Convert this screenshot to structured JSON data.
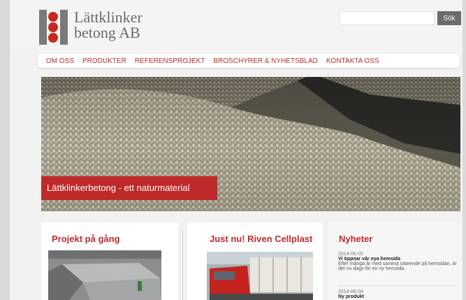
{
  "header": {
    "logo_line1": "Lättklinker",
    "logo_line2": "betong AB",
    "search_placeholder": "",
    "search_button": "Sök"
  },
  "nav": {
    "items": [
      "OM OSS",
      "PRODUKTER",
      "REFERENSPROJEKT",
      "BROSCHYRER & NYHETSBLAD",
      "KONTAKTA OSS"
    ]
  },
  "hero": {
    "caption": "Lättklinkerbetong - ett naturmaterial"
  },
  "columns": {
    "projects_title": "Projekt på gång",
    "news_flash_title": "Just nu! Riven Cellplast",
    "news_title": "Nyheter",
    "news": [
      {
        "date": "2014-06-05",
        "title": "Vi öppnar vår nya hemsida",
        "text": "Efter många år med samma utseende på hemsidan, är det nu dags för en ny hemsida."
      },
      {
        "date": "2014-06-04",
        "title": "Ny produkt"
      }
    ]
  },
  "colors": {
    "accent": "#c0292a",
    "nav_text": "#b83028"
  }
}
